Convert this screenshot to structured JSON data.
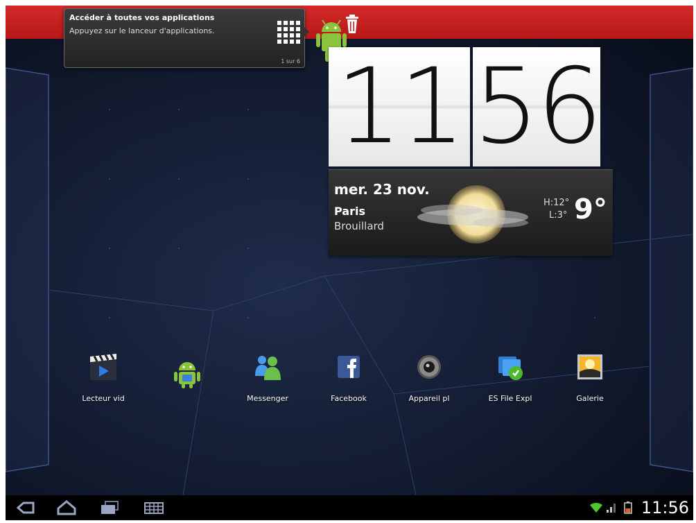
{
  "tooltip": {
    "title": "Accéder à toutes vos applications",
    "subtitle": "Appuyez sur le lanceur d'applications.",
    "page": "1 sur 6"
  },
  "clock": {
    "hours": "11",
    "minutes": "56"
  },
  "weather": {
    "date": "mer. 23 nov.",
    "city": "Paris",
    "condition": "Brouillard",
    "high": "H:12°",
    "low": "L:3°",
    "temp": "9°",
    "icon": "fog-sun-icon"
  },
  "dock": {
    "apps": [
      {
        "label": "Lecteur vid",
        "icon": "video-player-icon"
      },
      {
        "label": "",
        "icon": "android-app-icon"
      },
      {
        "label": "Messenger",
        "icon": "messenger-icon"
      },
      {
        "label": "Facebook",
        "icon": "facebook-icon"
      },
      {
        "label": "Appareil pl",
        "icon": "camera-icon"
      },
      {
        "label": "ES File Expl",
        "icon": "file-explorer-icon"
      },
      {
        "label": "Galerie",
        "icon": "gallery-icon"
      }
    ]
  },
  "status": {
    "time": "11:56"
  },
  "colors": {
    "topbar": "#c92020",
    "navbar": "#000000",
    "wifi": "#4cc82a",
    "battery": "#e8621c"
  }
}
